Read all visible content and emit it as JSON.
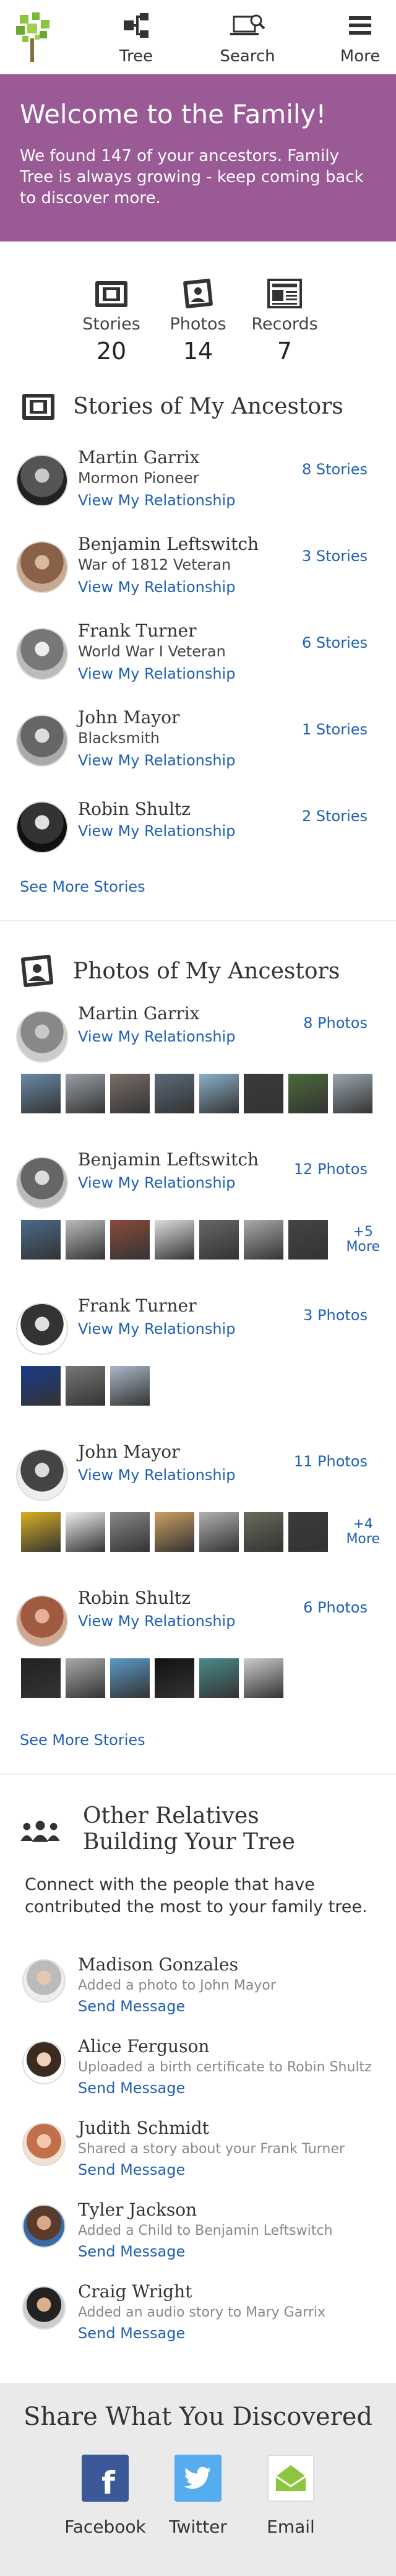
{
  "nav": {
    "tree_label": "Tree",
    "search_label": "Search",
    "more_label": "More"
  },
  "welcome": {
    "title": "Welcome to the Family!",
    "body": "We found 147 of your ancestors. Family Tree is always growing - keep coming back to discover more."
  },
  "stats": [
    {
      "label": "Stories",
      "count": "20"
    },
    {
      "label": "Photos",
      "count": "14"
    },
    {
      "label": "Records",
      "count": "7"
    }
  ],
  "stories": {
    "heading": "Stories of My Ancestors",
    "view_label": "View My Relationship",
    "see_more": "See More Stories",
    "items": [
      {
        "name": "Martin Garrix",
        "subtitle": "Mormon Pioneer",
        "count": "8 Stories"
      },
      {
        "name": "Benjamin Leftswitch",
        "subtitle": "War of 1812 Veteran",
        "count": "3 Stories"
      },
      {
        "name": "Frank Turner",
        "subtitle": "World War I Veteran",
        "count": "6 Stories"
      },
      {
        "name": "John Mayor",
        "subtitle": "Blacksmith",
        "count": "1 Stories"
      },
      {
        "name": "Robin Shultz",
        "subtitle": "",
        "count": "2 Stories"
      }
    ]
  },
  "photos": {
    "heading": "Photos of My Ancestors",
    "view_label": "View My Relationship",
    "see_more": "See More Stories",
    "items": [
      {
        "name": "Martin Garrix",
        "count": "8 Photos",
        "thumbs": 8,
        "more": ""
      },
      {
        "name": "Benjamin Leftswitch",
        "count": "12 Photos",
        "thumbs": 7,
        "more": "+5\nMore"
      },
      {
        "name": "Frank Turner",
        "count": "3 Photos",
        "thumbs": 3,
        "more": ""
      },
      {
        "name": "John Mayor",
        "count": "11 Photos",
        "thumbs": 7,
        "more": "+4\nMore"
      },
      {
        "name": "Robin Shultz",
        "count": "6 Photos",
        "thumbs": 6,
        "more": ""
      }
    ]
  },
  "relatives": {
    "heading": "Other Relatives Building Your Tree",
    "intro": "Connect with the people that have contributed the most to your family tree.",
    "send_label": "Send Message",
    "items": [
      {
        "name": "Madison Gonzales",
        "action": "Added a photo to John Mayor"
      },
      {
        "name": "Alice Ferguson",
        "action": "Uploaded a birth certificate to Robin Shultz"
      },
      {
        "name": "Judith Schmidt",
        "action": "Shared a story about your Frank Turner"
      },
      {
        "name": "Tyler Jackson",
        "action": "Added a Child to Benjamin Leftswitch"
      },
      {
        "name": "Craig Wright",
        "action": "Added an audio story to Mary Garrix"
      }
    ]
  },
  "share": {
    "heading": "Share What You Discovered",
    "items": [
      {
        "label": "Facebook",
        "icon": "facebook-icon",
        "color": "#3b5998"
      },
      {
        "label": "Twitter",
        "icon": "twitter-icon",
        "color": "#55acee"
      },
      {
        "label": "Email",
        "icon": "email-icon",
        "color": "#8cc63f"
      }
    ]
  },
  "colors": {
    "brand_purple": "#9a5a96",
    "link_blue": "#1f5fb4",
    "logo_green": "#8cc63f"
  }
}
